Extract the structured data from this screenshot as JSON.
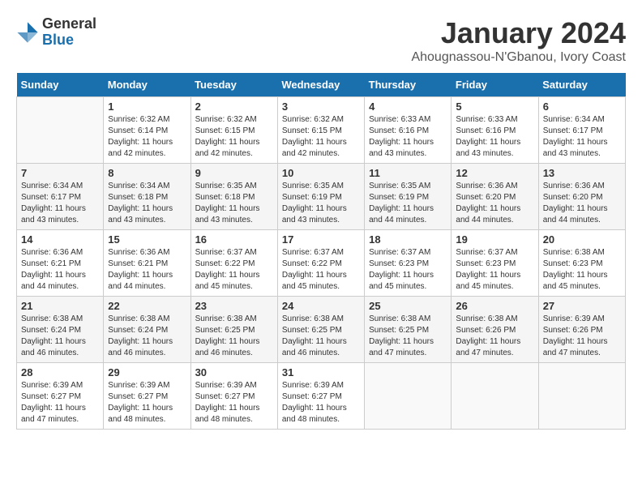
{
  "header": {
    "logo_general": "General",
    "logo_blue": "Blue",
    "month_title": "January 2024",
    "subtitle": "Ahougnassou-N'Gbanou, Ivory Coast"
  },
  "weekdays": [
    "Sunday",
    "Monday",
    "Tuesday",
    "Wednesday",
    "Thursday",
    "Friday",
    "Saturday"
  ],
  "weeks": [
    [
      {
        "day": "",
        "info": ""
      },
      {
        "day": "1",
        "info": "Sunrise: 6:32 AM\nSunset: 6:14 PM\nDaylight: 11 hours\nand 42 minutes."
      },
      {
        "day": "2",
        "info": "Sunrise: 6:32 AM\nSunset: 6:15 PM\nDaylight: 11 hours\nand 42 minutes."
      },
      {
        "day": "3",
        "info": "Sunrise: 6:32 AM\nSunset: 6:15 PM\nDaylight: 11 hours\nand 42 minutes."
      },
      {
        "day": "4",
        "info": "Sunrise: 6:33 AM\nSunset: 6:16 PM\nDaylight: 11 hours\nand 43 minutes."
      },
      {
        "day": "5",
        "info": "Sunrise: 6:33 AM\nSunset: 6:16 PM\nDaylight: 11 hours\nand 43 minutes."
      },
      {
        "day": "6",
        "info": "Sunrise: 6:34 AM\nSunset: 6:17 PM\nDaylight: 11 hours\nand 43 minutes."
      }
    ],
    [
      {
        "day": "7",
        "info": "Sunrise: 6:34 AM\nSunset: 6:17 PM\nDaylight: 11 hours\nand 43 minutes."
      },
      {
        "day": "8",
        "info": "Sunrise: 6:34 AM\nSunset: 6:18 PM\nDaylight: 11 hours\nand 43 minutes."
      },
      {
        "day": "9",
        "info": "Sunrise: 6:35 AM\nSunset: 6:18 PM\nDaylight: 11 hours\nand 43 minutes."
      },
      {
        "day": "10",
        "info": "Sunrise: 6:35 AM\nSunset: 6:19 PM\nDaylight: 11 hours\nand 43 minutes."
      },
      {
        "day": "11",
        "info": "Sunrise: 6:35 AM\nSunset: 6:19 PM\nDaylight: 11 hours\nand 44 minutes."
      },
      {
        "day": "12",
        "info": "Sunrise: 6:36 AM\nSunset: 6:20 PM\nDaylight: 11 hours\nand 44 minutes."
      },
      {
        "day": "13",
        "info": "Sunrise: 6:36 AM\nSunset: 6:20 PM\nDaylight: 11 hours\nand 44 minutes."
      }
    ],
    [
      {
        "day": "14",
        "info": "Sunrise: 6:36 AM\nSunset: 6:21 PM\nDaylight: 11 hours\nand 44 minutes."
      },
      {
        "day": "15",
        "info": "Sunrise: 6:36 AM\nSunset: 6:21 PM\nDaylight: 11 hours\nand 44 minutes."
      },
      {
        "day": "16",
        "info": "Sunrise: 6:37 AM\nSunset: 6:22 PM\nDaylight: 11 hours\nand 45 minutes."
      },
      {
        "day": "17",
        "info": "Sunrise: 6:37 AM\nSunset: 6:22 PM\nDaylight: 11 hours\nand 45 minutes."
      },
      {
        "day": "18",
        "info": "Sunrise: 6:37 AM\nSunset: 6:23 PM\nDaylight: 11 hours\nand 45 minutes."
      },
      {
        "day": "19",
        "info": "Sunrise: 6:37 AM\nSunset: 6:23 PM\nDaylight: 11 hours\nand 45 minutes."
      },
      {
        "day": "20",
        "info": "Sunrise: 6:38 AM\nSunset: 6:23 PM\nDaylight: 11 hours\nand 45 minutes."
      }
    ],
    [
      {
        "day": "21",
        "info": "Sunrise: 6:38 AM\nSunset: 6:24 PM\nDaylight: 11 hours\nand 46 minutes."
      },
      {
        "day": "22",
        "info": "Sunrise: 6:38 AM\nSunset: 6:24 PM\nDaylight: 11 hours\nand 46 minutes."
      },
      {
        "day": "23",
        "info": "Sunrise: 6:38 AM\nSunset: 6:25 PM\nDaylight: 11 hours\nand 46 minutes."
      },
      {
        "day": "24",
        "info": "Sunrise: 6:38 AM\nSunset: 6:25 PM\nDaylight: 11 hours\nand 46 minutes."
      },
      {
        "day": "25",
        "info": "Sunrise: 6:38 AM\nSunset: 6:25 PM\nDaylight: 11 hours\nand 47 minutes."
      },
      {
        "day": "26",
        "info": "Sunrise: 6:38 AM\nSunset: 6:26 PM\nDaylight: 11 hours\nand 47 minutes."
      },
      {
        "day": "27",
        "info": "Sunrise: 6:39 AM\nSunset: 6:26 PM\nDaylight: 11 hours\nand 47 minutes."
      }
    ],
    [
      {
        "day": "28",
        "info": "Sunrise: 6:39 AM\nSunset: 6:27 PM\nDaylight: 11 hours\nand 47 minutes."
      },
      {
        "day": "29",
        "info": "Sunrise: 6:39 AM\nSunset: 6:27 PM\nDaylight: 11 hours\nand 48 minutes."
      },
      {
        "day": "30",
        "info": "Sunrise: 6:39 AM\nSunset: 6:27 PM\nDaylight: 11 hours\nand 48 minutes."
      },
      {
        "day": "31",
        "info": "Sunrise: 6:39 AM\nSunset: 6:27 PM\nDaylight: 11 hours\nand 48 minutes."
      },
      {
        "day": "",
        "info": ""
      },
      {
        "day": "",
        "info": ""
      },
      {
        "day": "",
        "info": ""
      }
    ]
  ]
}
